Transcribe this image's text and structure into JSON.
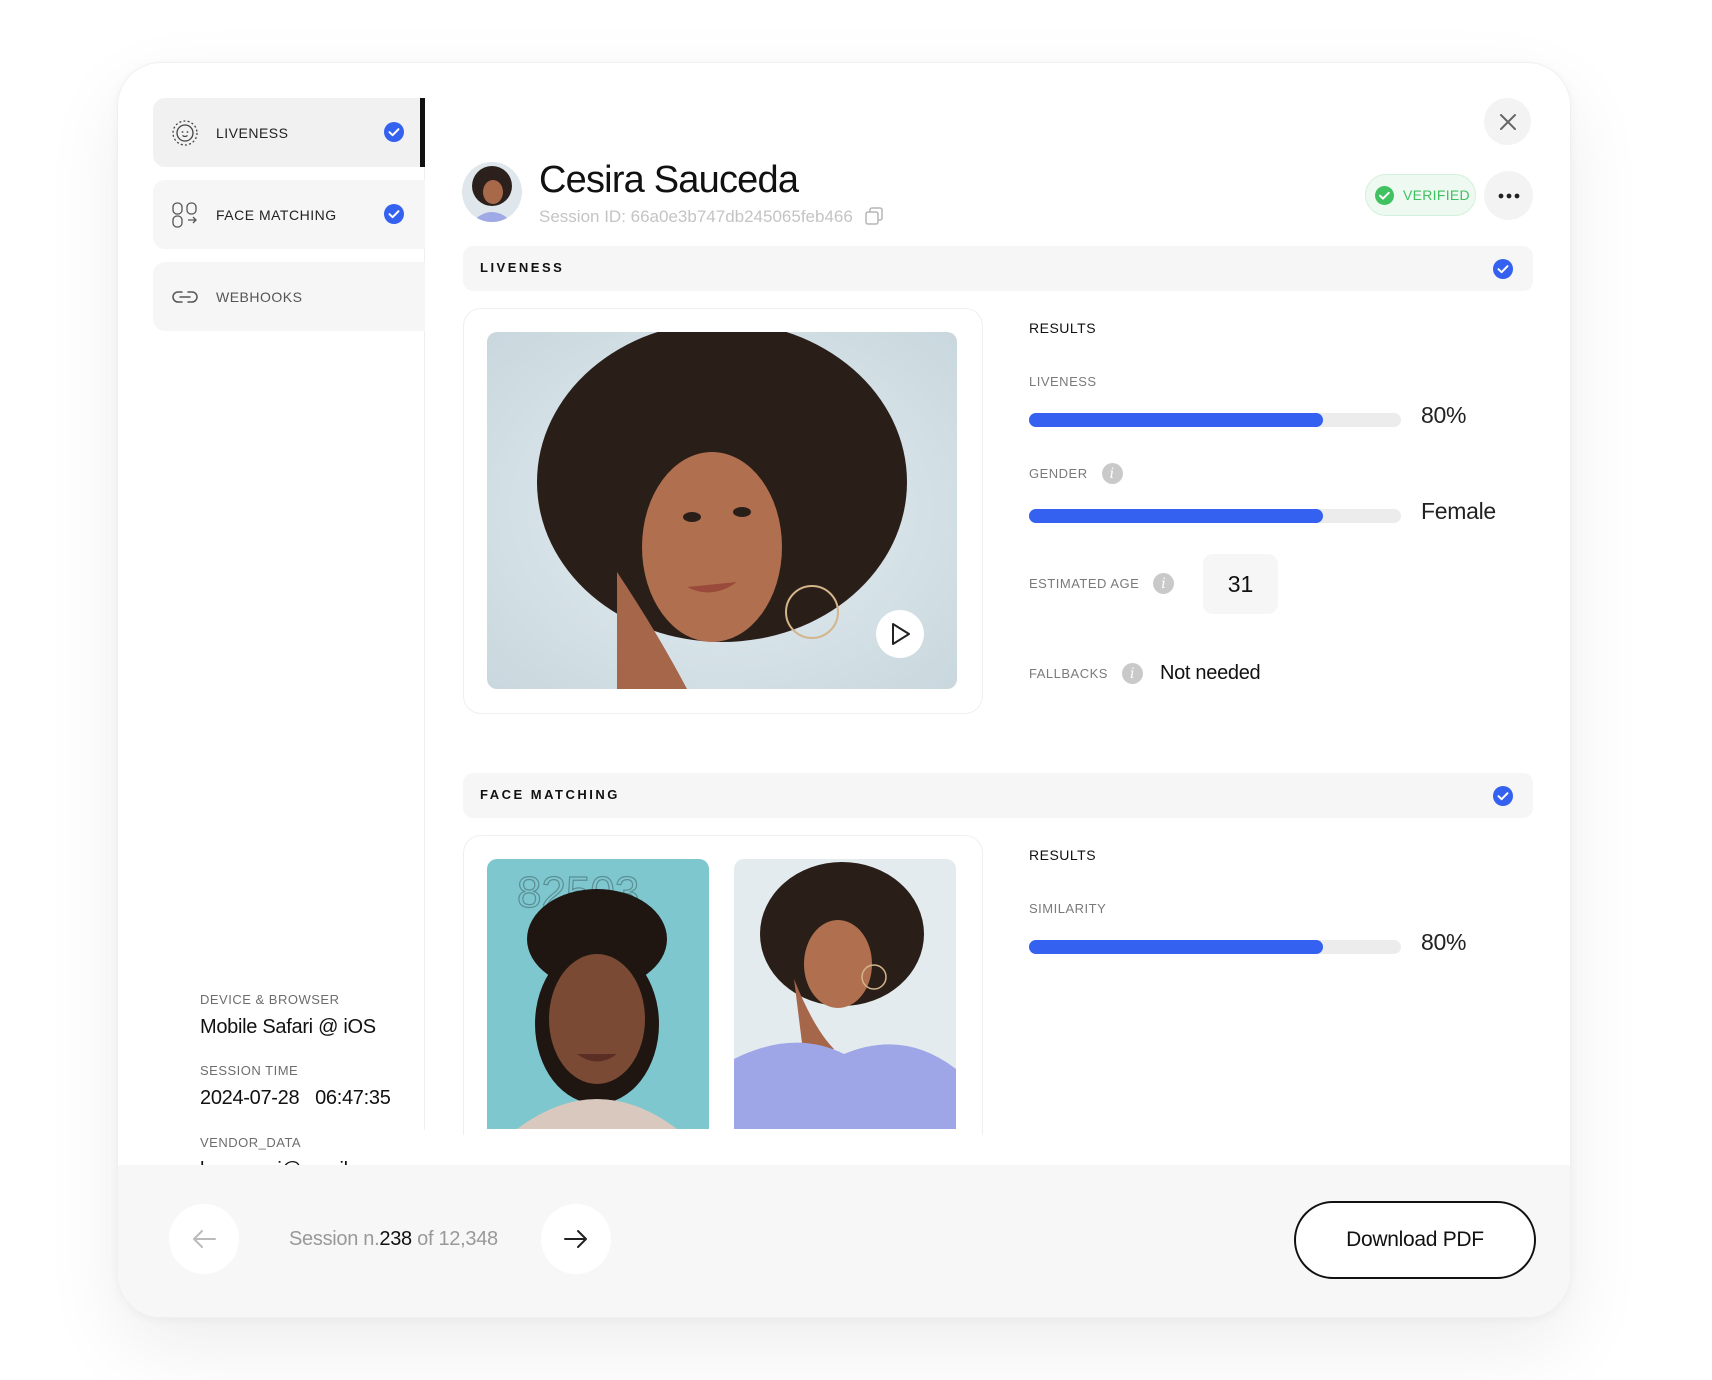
{
  "sidebar": {
    "items": [
      {
        "label": "LIVENESS",
        "icon": "liveness-icon",
        "checked": true
      },
      {
        "label": "FACE MATCHING",
        "icon": "face-matching-icon",
        "checked": true
      },
      {
        "label": "WEBHOOKS",
        "icon": "link-icon",
        "checked": false
      }
    ],
    "meta": [
      {
        "label": "DEVICE & BROWSER",
        "value": "Mobile Safari @ iOS"
      },
      {
        "label": "SESSION TIME",
        "value": "2024-07-28   06:47:35"
      },
      {
        "label": "VENDOR_DATA",
        "value": "luca.rossi@gmail.com"
      }
    ]
  },
  "header": {
    "name": "Cesira Sauceda",
    "session_id": "Session ID: 66a0e3b747db245065feb466",
    "status": "VERIFIED"
  },
  "liveness": {
    "title": "LIVENESS",
    "results_title": "RESULTS",
    "liveness_label": "LIVENESS",
    "liveness_value": "80%",
    "liveness_fraction": 0.79,
    "gender_label": "GENDER",
    "gender_value": "Female",
    "gender_fraction": 0.79,
    "age_label": "ESTIMATED AGE",
    "age_value": "31",
    "fallbacks_label": "FALLBACKS",
    "fallbacks_value": "Not needed"
  },
  "face_matching": {
    "title": "FACE MATCHING",
    "results_title": "RESULTS",
    "similarity_label": "SIMILARITY",
    "similarity_value": "80%",
    "similarity_fraction": 0.79
  },
  "footer": {
    "session_prefix": "Session n.",
    "session_number": "238",
    "session_suffix": " of 12,348",
    "download_label": "Download PDF"
  },
  "colors": {
    "accent": "#3461ef",
    "verified": "#3fbf5f"
  }
}
